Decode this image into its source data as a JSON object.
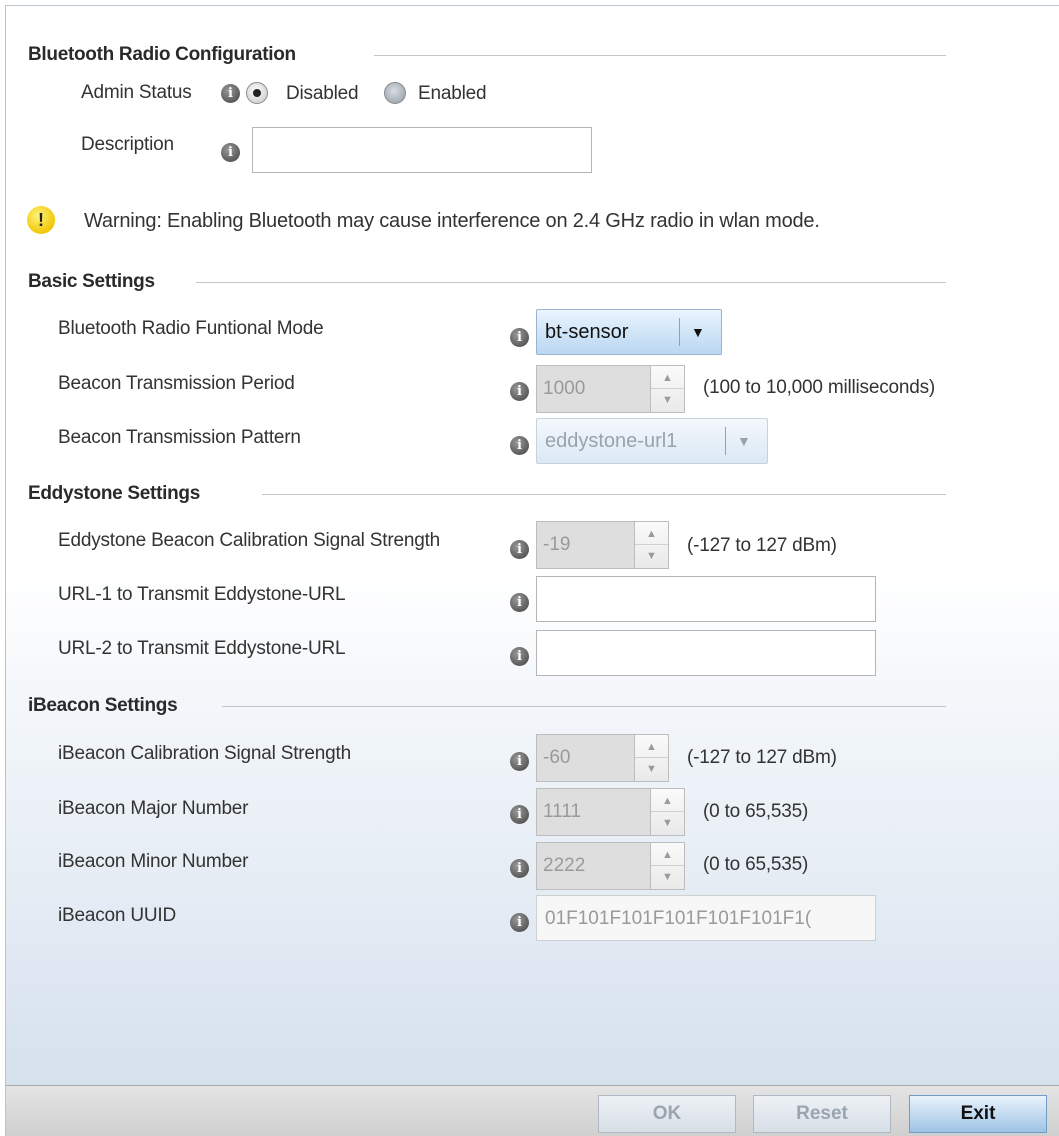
{
  "sections": {
    "bluetooth_radio_config": "Bluetooth Radio Configuration",
    "basic_settings": "Basic Settings",
    "eddystone_settings": "Eddystone Settings",
    "ibeacon_settings": "iBeacon Settings"
  },
  "admin_status": {
    "label": "Admin Status",
    "options": [
      "Disabled",
      "Enabled"
    ],
    "selected": "Disabled"
  },
  "description": {
    "label": "Description",
    "value": ""
  },
  "warning": "Warning: Enabling Bluetooth may cause interference on 2.4 GHz radio in wlan mode.",
  "basic": {
    "functional_mode_label": "Bluetooth Radio Funtional Mode",
    "functional_mode_value": "bt-sensor",
    "tx_period_label": "Beacon Transmission Period",
    "tx_period_value": "1000",
    "tx_period_range": "(100 to 10,000 milliseconds)",
    "tx_pattern_label": "Beacon Transmission Pattern",
    "tx_pattern_value": "eddystone-url1"
  },
  "eddystone": {
    "calibration_label": "Eddystone Beacon Calibration Signal Strength",
    "calibration_value": "-19",
    "calibration_range": "(-127 to 127 dBm)",
    "url1_label": "URL-1 to Transmit Eddystone-URL",
    "url1_value": "",
    "url2_label": "URL-2 to Transmit Eddystone-URL",
    "url2_value": ""
  },
  "ibeacon": {
    "calibration_label": "iBeacon Calibration Signal Strength",
    "calibration_value": "-60",
    "calibration_range": "(-127 to 127 dBm)",
    "major_label": "iBeacon Major Number",
    "major_value": "1111",
    "major_range": "(0 to 65,535)",
    "minor_label": "iBeacon Minor Number",
    "minor_value": "2222",
    "minor_range": "(0 to 65,535)",
    "uuid_label": "iBeacon UUID",
    "uuid_value": "01F101F101F101F101F101F1("
  },
  "buttons": {
    "ok": "OK",
    "reset": "Reset",
    "exit": "Exit"
  },
  "icons": {
    "info": "info-icon",
    "warning": "warning-icon",
    "dropdown": "chevron-down-icon"
  },
  "colors": {
    "exit_button": "#9fc3e5",
    "warning": "#f0c400"
  }
}
